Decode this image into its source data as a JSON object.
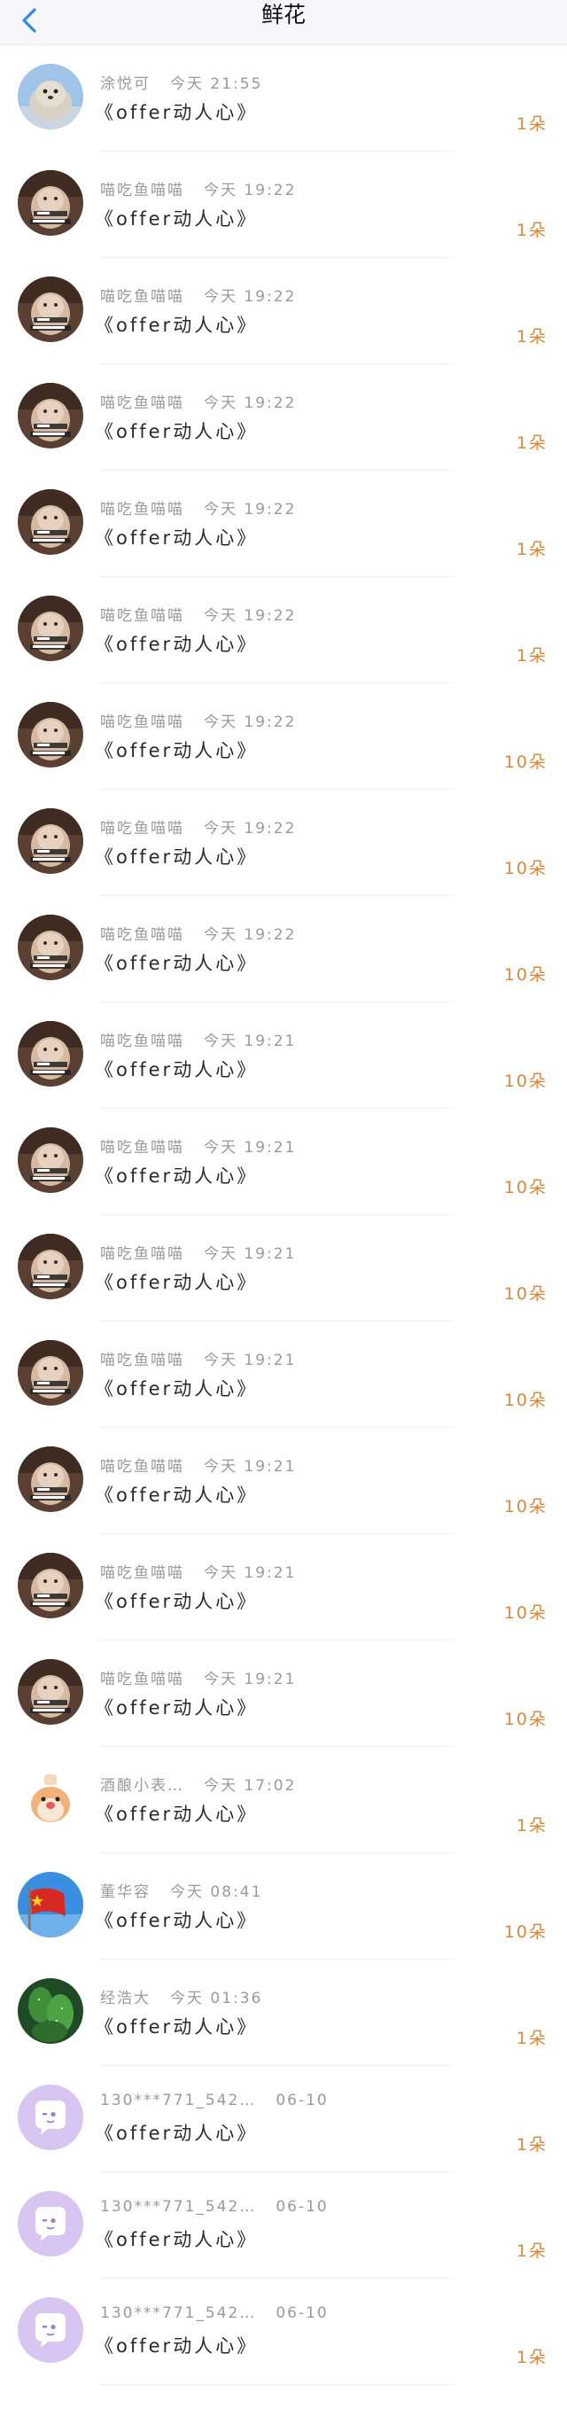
{
  "header": {
    "title": "鲜花",
    "back_icon": "chevron-left-icon",
    "accent": "#2f8ae5"
  },
  "records": [
    {
      "name": "涂悦可",
      "time": "今天 21:55",
      "gift": "《offer动人心》",
      "count": "1朵",
      "avatar": "seal-avatar"
    },
    {
      "name": "喵吃鱼喵喵",
      "time": "今天 19:22",
      "gift": "《offer动人心》",
      "count": "1朵",
      "avatar": "cat-meme-avatar"
    },
    {
      "name": "喵吃鱼喵喵",
      "time": "今天 19:22",
      "gift": "《offer动人心》",
      "count": "1朵",
      "avatar": "cat-meme-avatar"
    },
    {
      "name": "喵吃鱼喵喵",
      "time": "今天 19:22",
      "gift": "《offer动人心》",
      "count": "1朵",
      "avatar": "cat-meme-avatar"
    },
    {
      "name": "喵吃鱼喵喵",
      "time": "今天 19:22",
      "gift": "《offer动人心》",
      "count": "1朵",
      "avatar": "cat-meme-avatar"
    },
    {
      "name": "喵吃鱼喵喵",
      "time": "今天 19:22",
      "gift": "《offer动人心》",
      "count": "1朵",
      "avatar": "cat-meme-avatar"
    },
    {
      "name": "喵吃鱼喵喵",
      "time": "今天 19:22",
      "gift": "《offer动人心》",
      "count": "10朵",
      "avatar": "cat-meme-avatar"
    },
    {
      "name": "喵吃鱼喵喵",
      "time": "今天 19:22",
      "gift": "《offer动人心》",
      "count": "10朵",
      "avatar": "cat-meme-avatar"
    },
    {
      "name": "喵吃鱼喵喵",
      "time": "今天 19:22",
      "gift": "《offer动人心》",
      "count": "10朵",
      "avatar": "cat-meme-avatar"
    },
    {
      "name": "喵吃鱼喵喵",
      "time": "今天 19:21",
      "gift": "《offer动人心》",
      "count": "10朵",
      "avatar": "cat-meme-avatar"
    },
    {
      "name": "喵吃鱼喵喵",
      "time": "今天 19:21",
      "gift": "《offer动人心》",
      "count": "10朵",
      "avatar": "cat-meme-avatar"
    },
    {
      "name": "喵吃鱼喵喵",
      "time": "今天 19:21",
      "gift": "《offer动人心》",
      "count": "10朵",
      "avatar": "cat-meme-avatar"
    },
    {
      "name": "喵吃鱼喵喵",
      "time": "今天 19:21",
      "gift": "《offer动人心》",
      "count": "10朵",
      "avatar": "cat-meme-avatar"
    },
    {
      "name": "喵吃鱼喵喵",
      "time": "今天 19:21",
      "gift": "《offer动人心》",
      "count": "10朵",
      "avatar": "cat-meme-avatar"
    },
    {
      "name": "喵吃鱼喵喵",
      "time": "今天 19:21",
      "gift": "《offer动人心》",
      "count": "10朵",
      "avatar": "cat-meme-avatar"
    },
    {
      "name": "喵吃鱼喵喵",
      "time": "今天 19:21",
      "gift": "《offer动人心》",
      "count": "10朵",
      "avatar": "cat-meme-avatar"
    },
    {
      "name": "酒酿小表…",
      "time": "今天 17:02",
      "gift": "《offer动人心》",
      "count": "1朵",
      "avatar": "hamster-avatar"
    },
    {
      "name": "董华容",
      "time": "今天 08:41",
      "gift": "《offer动人心》",
      "count": "10朵",
      "avatar": "flag-avatar"
    },
    {
      "name": "经浩大",
      "time": "今天 01:36",
      "gift": "《offer动人心》",
      "count": "1朵",
      "avatar": "cactus-avatar"
    },
    {
      "name": "130***771_542…",
      "time": "06-10",
      "gift": "《offer动人心》",
      "count": "1朵",
      "avatar": "default-chat-avatar"
    },
    {
      "name": "130***771_542…",
      "time": "06-10",
      "gift": "《offer动人心》",
      "count": "1朵",
      "avatar": "default-chat-avatar"
    },
    {
      "name": "130***771_542…",
      "time": "06-10",
      "gift": "《offer动人心》",
      "count": "1朵",
      "avatar": "default-chat-avatar"
    }
  ]
}
